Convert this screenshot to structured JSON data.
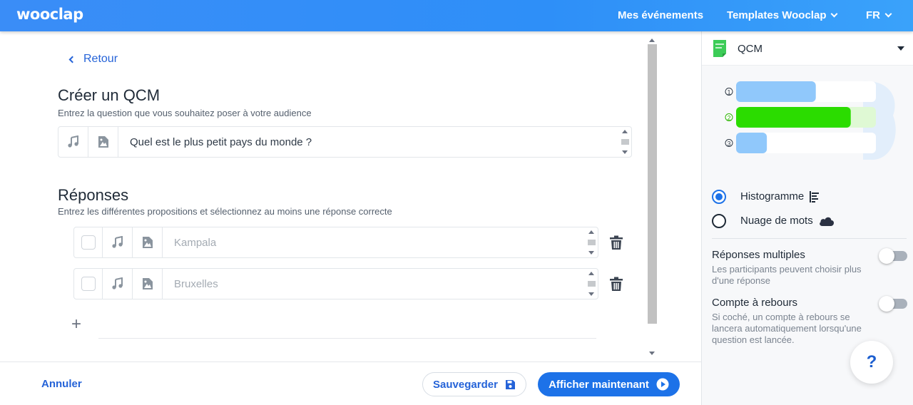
{
  "app": {
    "logo": "wooclap"
  },
  "nav": {
    "events": "Mes événements",
    "templates": "Templates Wooclap",
    "lang": "FR"
  },
  "editor": {
    "back": "Retour",
    "title": "Créer un QCM",
    "subtitle": "Entrez la question que vous souhaitez poser à votre audience",
    "question": "Quel est le plus petit pays du monde ?",
    "answers_title": "Réponses",
    "answers_subtitle": "Entrez les différentes propositions et sélectionnez au moins une réponse correcte",
    "answers": [
      {
        "placeholder": "Kampala"
      },
      {
        "placeholder": "Bruxelles"
      }
    ],
    "add_symbol": "+"
  },
  "footer": {
    "cancel": "Annuler",
    "save": "Sauvegarder",
    "show": "Afficher maintenant"
  },
  "panel": {
    "question_type": "QCM",
    "preview_numbers": [
      "1",
      "2",
      "3"
    ],
    "preview_bars": [
      0.57,
      0.82,
      0.22
    ],
    "colors": {
      "bar_blue": "#90c8fb",
      "bar_green": "#2bdc00",
      "accent": "#1d72e8"
    },
    "display_options": [
      {
        "label": "Histogramme",
        "selected": true,
        "icon": "histogram-icon"
      },
      {
        "label": "Nuage de mots",
        "selected": false,
        "icon": "cloud-icon"
      }
    ],
    "multiple": {
      "title": "Réponses multiples",
      "desc": "Les participants peuvent choisir plus d'une réponse"
    },
    "countdown": {
      "title": "Compte à rebours",
      "desc": "Si coché, un compte à rebours se lancera automatiquement lorsqu'une question est lancée."
    },
    "help": "?"
  }
}
